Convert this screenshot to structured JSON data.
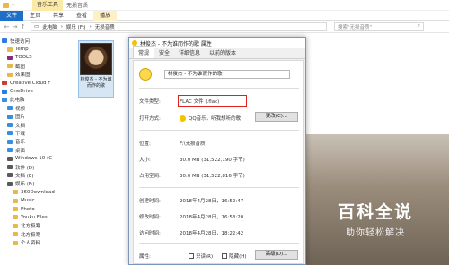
{
  "window": {
    "title": "无损音质",
    "context_tab": "音乐工具"
  },
  "ribbon": {
    "tabs": [
      "文件",
      "主页",
      "共享",
      "查看",
      "播放"
    ]
  },
  "address": {
    "path": [
      "此电脑",
      "娱乐 (F:)",
      "无损音质"
    ],
    "search_placeholder": "搜索\"无损音质\""
  },
  "sidebar": {
    "items": [
      {
        "label": "快速访问",
        "icon": "star-icon",
        "color": "#2c7be5"
      },
      {
        "label": "Temp",
        "icon": "folder-icon",
        "color": "#e7b94a"
      },
      {
        "label": "TOOLS",
        "icon": "folder-icon",
        "color": "#8a2a7a"
      },
      {
        "label": "截图",
        "icon": "folder-icon",
        "color": "#e7b94a"
      },
      {
        "label": "效果图",
        "icon": "folder-icon",
        "color": "#e7b94a"
      },
      {
        "label": "Creative Cloud F",
        "icon": "cloud-icon",
        "color": "#d23a2a"
      },
      {
        "label": "OneDrive",
        "icon": "onedrive-icon",
        "color": "#2c7be5"
      },
      {
        "label": "此电脑",
        "icon": "computer-icon",
        "color": "#3a8de0"
      },
      {
        "label": "视频",
        "icon": "video-icon",
        "color": "#3a8de0"
      },
      {
        "label": "图片",
        "icon": "picture-icon",
        "color": "#3a8de0"
      },
      {
        "label": "文档",
        "icon": "document-icon",
        "color": "#3a8de0"
      },
      {
        "label": "下载",
        "icon": "download-icon",
        "color": "#3a8de0"
      },
      {
        "label": "音乐",
        "icon": "music-icon",
        "color": "#3a8de0"
      },
      {
        "label": "桌面",
        "icon": "desktop-icon",
        "color": "#3a8de0"
      },
      {
        "label": "Windows 10 (C",
        "icon": "drive-icon",
        "color": "#5a5a5a"
      },
      {
        "label": "软件 (D)",
        "icon": "drive-icon",
        "color": "#5a5a5a"
      },
      {
        "label": "文档 (E)",
        "icon": "drive-icon",
        "color": "#5a5a5a"
      },
      {
        "label": "娱乐 (F:)",
        "icon": "drive-icon",
        "color": "#5a5a5a"
      },
      {
        "label": "360Download",
        "icon": "folder-icon",
        "color": "#e7b94a"
      },
      {
        "label": "Music",
        "icon": "folder-icon",
        "color": "#e7b94a"
      },
      {
        "label": "Photo",
        "icon": "folder-icon",
        "color": "#e7b94a"
      },
      {
        "label": "Youku Files",
        "icon": "folder-icon",
        "color": "#e7b94a"
      },
      {
        "label": "北方极寒",
        "icon": "folder-icon",
        "color": "#e7b94a"
      },
      {
        "label": "北方极寒",
        "icon": "folder-icon",
        "color": "#e7b94a"
      },
      {
        "label": "个人资料",
        "icon": "folder-icon",
        "color": "#e7b94a"
      }
    ]
  },
  "file": {
    "label": "林俊杰 - 不为谁而作的歌"
  },
  "dialog": {
    "title": "林俊杰 - 不为谁而作的歌 属性",
    "tabs": [
      "常规",
      "安全",
      "详细信息",
      "以前的版本"
    ],
    "name": "林俊杰 - 不为谁而作的歌",
    "file_type_label": "文件类型:",
    "file_type": "FLAC 文件 (.flac)",
    "open_with_label": "打开方式:",
    "open_with": "QQ音乐，听我想听的歌",
    "change_button": "更改(C)...",
    "location_label": "位置:",
    "location": "F:\\无损音质",
    "size_label": "大小:",
    "size": "30.0 MB (31,522,190 字节)",
    "disk_size_label": "占用空间:",
    "disk_size": "30.0 MB (31,522,816 字节)",
    "created_label": "创建时间:",
    "created": "2018年4月28日，16:52:47",
    "modified_label": "修改时间:",
    "modified": "2018年4月28日，16:53:20",
    "accessed_label": "访问时间:",
    "accessed": "2018年4月28日，18:22:42",
    "attributes_label": "属性:",
    "readonly_label": "只读(R)",
    "hidden_label": "隐藏(H)",
    "advanced_button": "高级(D)..."
  },
  "watermark": {
    "line1": "百科全说",
    "line2": "助你轻松解决"
  }
}
